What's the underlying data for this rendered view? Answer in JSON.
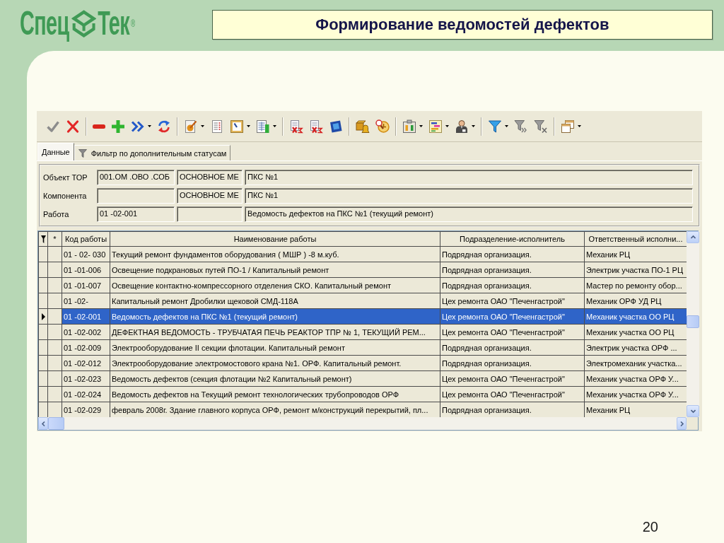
{
  "logo": {
    "part_1": "Спец",
    "part_2": "Тек",
    "mark": "®"
  },
  "title": "Формирование ведомостей дефектов",
  "app": {
    "toolbar": {
      "groups": [
        {
          "buttons": [
            {
              "dropdown": false
            },
            {
              "dropdown": false
            }
          ]
        },
        {
          "buttons": [
            {
              "dropdown": false
            },
            {
              "dropdown": false
            },
            {
              "dropdown": true
            },
            {
              "dropdown": false
            }
          ]
        },
        {
          "buttons": [
            {
              "dropdown": true
            },
            {
              "dropdown": false
            },
            {
              "dropdown": true
            },
            {
              "dropdown": true
            }
          ]
        },
        {
          "buttons": [
            {
              "dropdown": false
            },
            {
              "dropdown": false
            },
            {
              "dropdown": false
            }
          ]
        },
        {
          "buttons": [
            {
              "dropdown": false
            },
            {
              "dropdown": false
            }
          ]
        },
        {
          "buttons": [
            {
              "dropdown": true
            },
            {
              "dropdown": true
            },
            {
              "dropdown": true
            }
          ]
        },
        {
          "buttons": [
            {
              "dropdown": true
            },
            {
              "dropdown": false
            },
            {
              "dropdown": false
            }
          ]
        },
        {
          "buttons": [
            {
              "dropdown": true
            }
          ]
        }
      ]
    },
    "tabs": [
      {
        "label": "Данные",
        "selected": true,
        "kind": "plain"
      },
      {
        "label": "Фильтр по дополнительным статусам",
        "selected": false,
        "kind": "filter"
      }
    ],
    "form": {
      "rows": [
        {
          "label": "Объект ТОР",
          "field_1": "001.ОМ .ОВО .СОБ",
          "field_2": "ОСНОВНОЕ МЕ",
          "field_3": "ПКС №1"
        },
        {
          "label": "Компонента",
          "field_2": "ОСНОВНОЕ МЕ",
          "field_3": "ПКС №1"
        },
        {
          "label": "Работа",
          "field_1": "01 -02-001",
          "field_3": "Ведомость дефектов на ПКС №1 (текущий ремонт)"
        }
      ]
    },
    "table": {
      "columns": [
        "*",
        "Код работы",
        "Наименование работы",
        "Подразделение-исполнитель",
        "Ответственный исполни..."
      ],
      "rows": [
        {
          "selected": false,
          "cells": [
            "",
            "01 - 02- 030",
            "Текущий ремонт фундаментов оборудования ( МШР ) -8 м.куб.",
            "Подрядная организация.",
            "Механик РЦ"
          ]
        },
        {
          "selected": false,
          "cells": [
            "",
            "01 -01-006",
            "Освещение подкрановых путей ПО-1 / Капитальный ремонт",
            "Подрядная организация.",
            "Электрик участка ПО-1 РЦ"
          ]
        },
        {
          "selected": false,
          "cells": [
            "",
            "01 -01-007",
            "Освещение контактно-компрессорного отделения СКО. Капитальный ремонт",
            "Подрядная организация.",
            "Мастер по ремонту обор..."
          ]
        },
        {
          "selected": false,
          "cells": [
            "",
            "01 -02-",
            "Капитальный ремонт Дробилки щековой СМД-118А",
            "Цех ремонта ОАО \"Печенгастрой\"",
            "Механик ОРФ УД РЦ"
          ]
        },
        {
          "selected": true,
          "cells": [
            "",
            "01 -02-001",
            "Ведомость дефектов на ПКС №1 (текущий ремонт)",
            "Цех ремонта ОАО \"Печенгастрой\"",
            "Механик участка ОО РЦ"
          ]
        },
        {
          "selected": false,
          "cells": [
            "",
            "01 -02-002",
            "ДЕФЕКТНАЯ ВЕДОМОСТЬ - ТРУБЧАТАЯ ПЕЧЬ РЕАКТОР ТПР № 1, ТЕКУЩИЙ РЕМ...",
            "Цех ремонта ОАО \"Печенгастрой\"",
            "Механик участка ОО РЦ"
          ]
        },
        {
          "selected": false,
          "cells": [
            "",
            "01 -02-009",
            "Электрооборудование II секции флотации. Капитальный ремонт",
            "Подрядная организация.",
            "Электрик участка ОРФ ..."
          ]
        },
        {
          "selected": false,
          "cells": [
            "",
            "01 -02-012",
            "Электрооборудование электромостового крана №1. ОРФ. Капитальный ремонт.",
            "Подрядная организация.",
            "Электромеханик участка..."
          ]
        },
        {
          "selected": false,
          "cells": [
            "",
            "01 -02-023",
            "Ведомость дефектов (секция флотации №2 Капитальный ремонт)",
            "Цех ремонта ОАО \"Печенгастрой\"",
            "Механик участка ОРФ У..."
          ]
        },
        {
          "selected": false,
          "cells": [
            "",
            "01 -02-024",
            "Ведомость дефектов на Текущий ремонт технологических трубопроводов ОРФ",
            "Цех ремонта ОАО \"Печенгастрой\"",
            "Механик участка ОРФ У..."
          ]
        },
        {
          "selected": false,
          "cells": [
            "",
            "01 -02-029",
            "февраль 2008г. Здание главного корпуса ОРФ, ремонт м/конструкций перекрытий, пл...",
            "Подрядная организация.",
            "Механик РЦ"
          ]
        }
      ]
    }
  },
  "page_number": "20"
}
